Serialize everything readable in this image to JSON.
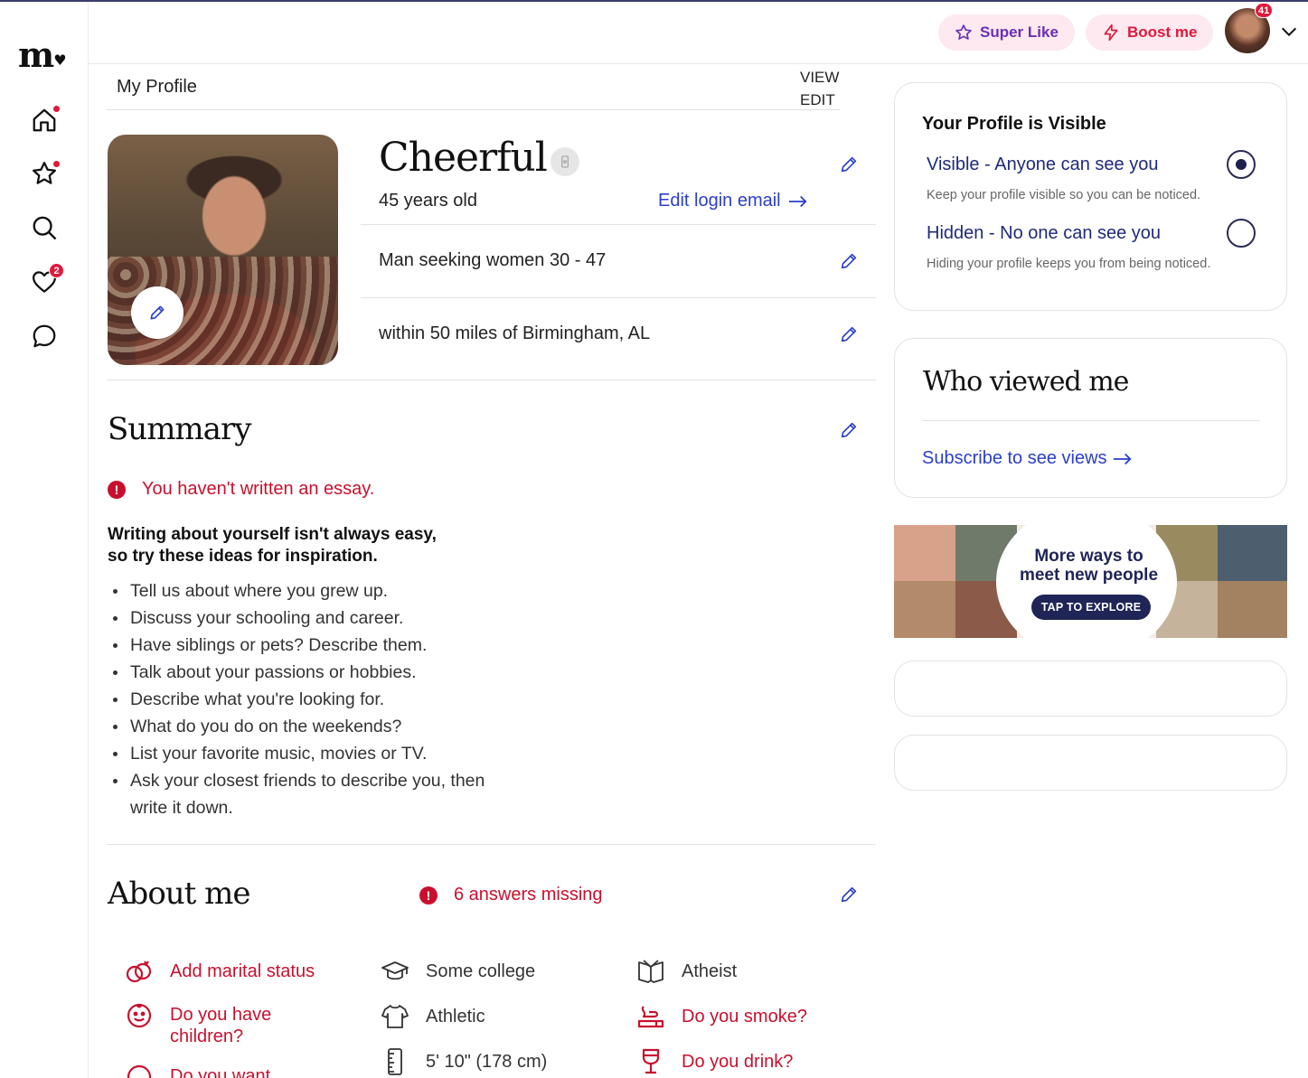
{
  "app": {
    "logo_text": "m"
  },
  "sidebar": {
    "items": [
      {
        "name": "home",
        "badge": ""
      },
      {
        "name": "favorites",
        "badge": ""
      },
      {
        "name": "search",
        "badge": ""
      },
      {
        "name": "likes",
        "badge": "2"
      },
      {
        "name": "messages",
        "badge": ""
      }
    ]
  },
  "header": {
    "super_like_label": "Super Like",
    "boost_label": "Boost me",
    "notification_count": "41"
  },
  "profile": {
    "breadcrumb": "My Profile",
    "view_label": "VIEW",
    "edit_label": "EDIT",
    "name": "Cheerful",
    "age": "45 years old",
    "edit_login_email": "Edit login email",
    "seeking": "Man seeking women 30 - 47",
    "location": "within 50 miles of Birmingham, AL"
  },
  "summary": {
    "title": "Summary",
    "warning": "You haven't written an essay.",
    "tips_heading_line1": "Writing about yourself isn't always easy,",
    "tips_heading_line2": "so try these ideas for inspiration.",
    "tips": [
      "Tell us about where you grew up.",
      "Discuss your schooling and career.",
      "Have siblings or pets? Describe them.",
      "Talk about your passions or hobbies.",
      "Describe what you're looking for.",
      "What do you do on the weekends?",
      "List your favorite music, movies or TV.",
      "Ask your closest friends to describe you, then write it down."
    ]
  },
  "about": {
    "title": "About me",
    "missing": "6 answers missing",
    "items": [
      {
        "icon": "rings-icon",
        "label": "Add marital status",
        "missing": true
      },
      {
        "icon": "graduation-cap-icon",
        "label": "Some college",
        "missing": false
      },
      {
        "icon": "book-icon",
        "label": "Atheist",
        "missing": false
      },
      {
        "icon": "baby-face-icon",
        "label": "Do you have children?",
        "missing": true
      },
      {
        "icon": "shirt-icon",
        "label": "Athletic",
        "missing": false
      },
      {
        "icon": "smoke-icon",
        "label": "Do you smoke?",
        "missing": true
      },
      {
        "icon": "rings-icon",
        "label": "Do you want",
        "missing": true
      },
      {
        "icon": "ruler-icon",
        "label": "5' 10\" (178 cm)",
        "missing": false
      },
      {
        "icon": "wine-glass-icon",
        "label": "Do you drink?",
        "missing": true
      }
    ]
  },
  "visibility": {
    "title": "Your Profile is Visible",
    "visible_label": "Visible - Anyone can see you",
    "visible_sub": "Keep your profile visible so you can be noticed.",
    "hidden_label": "Hidden - No one can see you",
    "hidden_sub": "Hiding your profile keeps you from being noticed.",
    "selected": "visible"
  },
  "who_viewed": {
    "title": "Who viewed me",
    "link": "Subscribe to see views"
  },
  "promo": {
    "line1": "More ways to",
    "line2": "meet new people",
    "button": "TAP TO EXPLORE"
  },
  "colors": {
    "accent_red": "#c8102e",
    "link_blue": "#2b3fc9",
    "navy": "#1f2557"
  }
}
